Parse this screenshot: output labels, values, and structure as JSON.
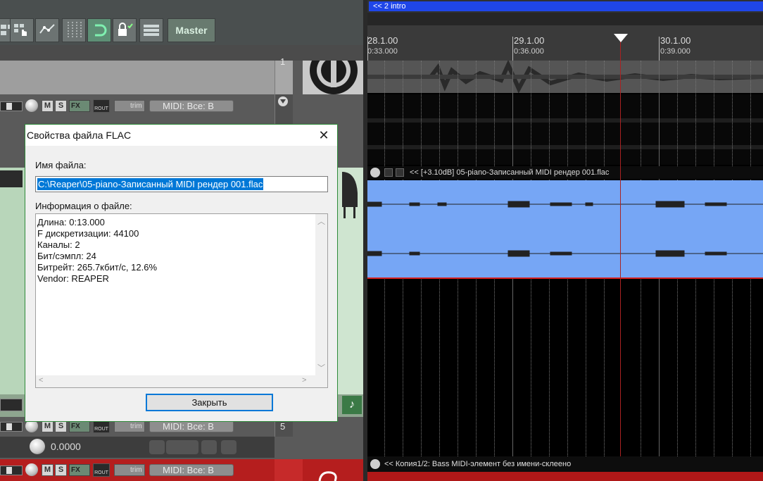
{
  "toolbar": {
    "master_label": "Master"
  },
  "tracks": {
    "track_numbers": [
      "1",
      "5"
    ],
    "midi_input_label": "MIDI: Все: В",
    "mute_label": "M",
    "solo_label": "S",
    "fx_label": "FX",
    "rout_label": "ROUT",
    "trim_label": "trim",
    "volume_value": "0.0000"
  },
  "arrange": {
    "region_label": "<< 2  intro",
    "ruler": [
      {
        "measure": "28.1.00",
        "time": "0:33.000"
      },
      {
        "measure": "29.1.00",
        "time": "0:36.000"
      },
      {
        "measure": "30.1.00",
        "time": "0:39.000"
      }
    ],
    "item_header": "<< [+3.10dB] 05-piano-Записанный MIDI  рендер 001.flac",
    "bottom_item_label": "<< Копия1/2: Bass MIDI-элемент без имени-склеено",
    "item_color": "#76a6f5",
    "region_color": "#1f46e8"
  },
  "dialog": {
    "title": "Свойства файла FLAC",
    "filename_label": "Имя файла:",
    "filename_value": "C:\\Reaper\\05-piano-Записанный MIDI  рендер 001.flac",
    "info_label": "Информация о файле:",
    "info_lines": [
      "Длина: 0:13.000",
      "F дискретизации: 44100",
      "Каналы: 2",
      "Бит/сэмпл: 24",
      "Битрейт: 265.7кбит/с, 12.6%",
      "Vendor: REAPER"
    ],
    "close_button": "Закрыть"
  }
}
